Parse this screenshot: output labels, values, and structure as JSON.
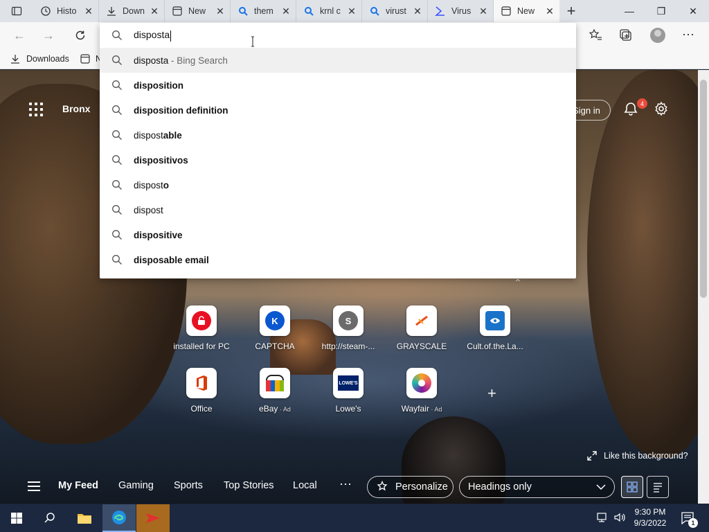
{
  "tabs": [
    {
      "icon": "history-icon",
      "title": "Histo"
    },
    {
      "icon": "download-icon",
      "title": "Down"
    },
    {
      "icon": "newtab-icon",
      "title": "New"
    },
    {
      "icon": "search-tab-icon",
      "title": "them"
    },
    {
      "icon": "search-tab-icon",
      "title": "krnl c"
    },
    {
      "icon": "search-tab-icon",
      "title": "virust"
    },
    {
      "icon": "virustotal-icon",
      "title": "Virus"
    },
    {
      "icon": "newtab-icon",
      "title": "New",
      "active": true
    }
  ],
  "favorites": {
    "downloads_label": "Downloads",
    "second_item": "N"
  },
  "search": {
    "value": "disposta"
  },
  "suggestions": [
    {
      "typed": "disposta",
      "rest": "",
      "suffix": " - Bing Search",
      "highlighted": true
    },
    {
      "typed": "",
      "rest": "disposition",
      "suffix": ""
    },
    {
      "typed": "",
      "rest": "disposition definition",
      "suffix": ""
    },
    {
      "typed": "dispost",
      "rest": "able",
      "suffix": ""
    },
    {
      "typed": "",
      "rest": "dispositivos",
      "suffix": ""
    },
    {
      "typed": "dispost",
      "rest": "o",
      "suffix": ""
    },
    {
      "typed": "dispost",
      "rest": "",
      "suffix": ""
    },
    {
      "typed": "",
      "rest": "dispositive",
      "suffix": ""
    },
    {
      "typed": "",
      "rest": "disposable email",
      "suffix": ""
    }
  ],
  "header": {
    "location": "Bronx",
    "sign_in": "Sign in",
    "notification_count": "4"
  },
  "quick_links": [
    {
      "label": "installed for PC",
      "ad": "",
      "icon": "lock-icon",
      "color": "#e81123"
    },
    {
      "label": "CAPTCHA",
      "ad": "",
      "icon": "k-letter-icon",
      "color": "#0b57d0",
      "letter": "K"
    },
    {
      "label": "http://steam-...",
      "ad": "",
      "icon": "s-letter-icon",
      "color": "#6b6b6b",
      "letter": "S"
    },
    {
      "label": "GRAYSCALE",
      "ad": "",
      "icon": "grayscale-icon",
      "color": "#e8531e"
    },
    {
      "label": "Cult.of.the.La...",
      "ad": "",
      "icon": "cult-icon",
      "color": "#1a73c8"
    },
    {
      "label": "Office",
      "ad": "",
      "icon": "office-icon",
      "color": "#d83b01"
    },
    {
      "label": "eBay",
      "ad": "Ad",
      "icon": "ebay-icon",
      "color": "#e53238"
    },
    {
      "label": "Lowe's",
      "ad": "",
      "icon": "lowes-icon",
      "color": "#012169"
    },
    {
      "label": "Wayfair",
      "ad": "Ad",
      "icon": "wayfair-icon",
      "color": "#7b189f"
    }
  ],
  "background": {
    "like_label": "Like this background?"
  },
  "feed": {
    "tabs": [
      "My Feed",
      "Gaming",
      "Sports",
      "Top Stories",
      "Local"
    ],
    "personalize": "Personalize",
    "headings_select": "Headings only"
  },
  "taskbar": {
    "time": "9:30 PM",
    "date": "9/3/2022",
    "notification_count": "1"
  },
  "colors": {
    "accent": "#0078d4",
    "badge": "#e74c3c",
    "taskbar": "#1b2840"
  }
}
